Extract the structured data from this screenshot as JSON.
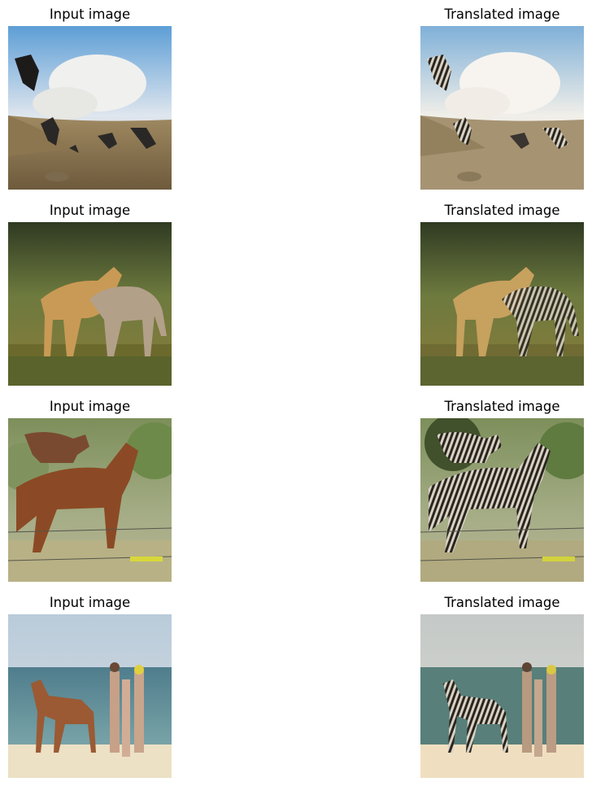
{
  "rows": [
    {
      "input_title": "Input image",
      "output_title": "Translated image"
    },
    {
      "input_title": "Input image",
      "output_title": "Translated image"
    },
    {
      "input_title": "Input image",
      "output_title": "Translated image"
    },
    {
      "input_title": "Input image",
      "output_title": "Translated image"
    }
  ]
}
